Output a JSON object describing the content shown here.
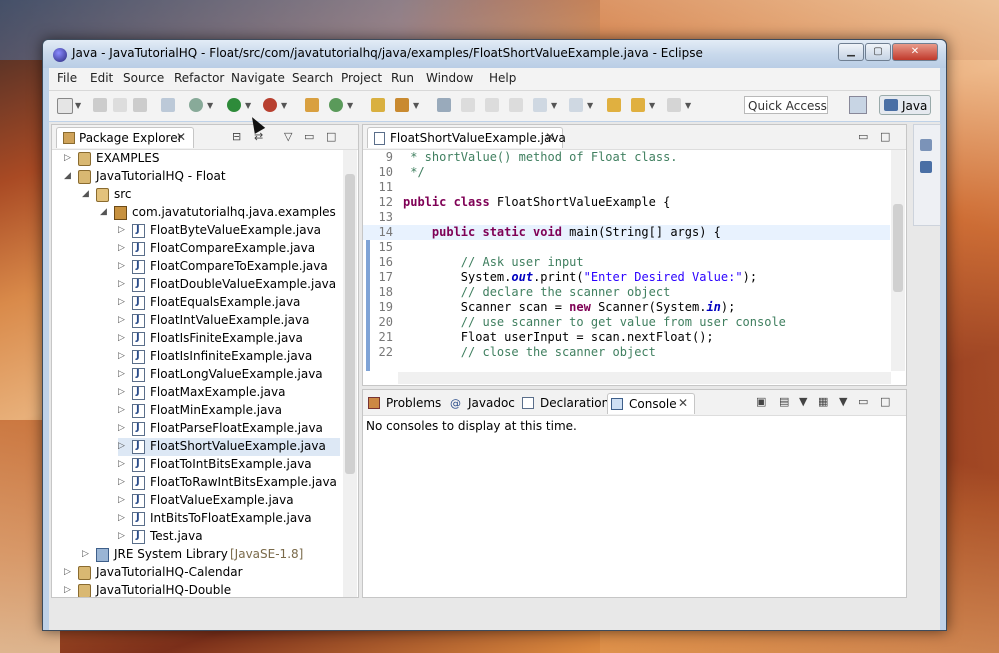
{
  "window": {
    "title": "Java - JavaTutorialHQ - Float/src/com/javatutorialhq/java/examples/FloatShortValueExample.java - Eclipse",
    "controls": [
      "minimize",
      "maximize",
      "close"
    ]
  },
  "menu": [
    "File",
    "Edit",
    "Source",
    "Refactor",
    "Navigate",
    "Search",
    "Project",
    "Run",
    "Window",
    "Help"
  ],
  "toolbar": {
    "quick_access": "Quick Access",
    "perspective": "Java"
  },
  "package_explorer": {
    "tab_label": "Package Explorer",
    "tree": [
      {
        "label": "EXAMPLES",
        "expanded": false,
        "type": "project"
      },
      {
        "label": "JavaTutorialHQ - Float",
        "expanded": true,
        "type": "project"
      },
      {
        "label": "src",
        "expanded": true,
        "type": "source-folder"
      },
      {
        "label": "com.javatutorialhq.java.examples",
        "expanded": true,
        "type": "package"
      },
      {
        "label": "FloatByteValueExample.java",
        "type": "java-file"
      },
      {
        "label": "FloatCompareExample.java",
        "type": "java-file"
      },
      {
        "label": "FloatCompareToExample.java",
        "type": "java-file"
      },
      {
        "label": "FloatDoubleValueExample.java",
        "type": "java-file"
      },
      {
        "label": "FloatEqualsExample.java",
        "type": "java-file"
      },
      {
        "label": "FloatIntValueExample.java",
        "type": "java-file"
      },
      {
        "label": "FloatIsFiniteExample.java",
        "type": "java-file"
      },
      {
        "label": "FloatIsInfiniteExample.java",
        "type": "java-file"
      },
      {
        "label": "FloatLongValueExample.java",
        "type": "java-file"
      },
      {
        "label": "FloatMaxExample.java",
        "type": "java-file"
      },
      {
        "label": "FloatMinExample.java",
        "type": "java-file"
      },
      {
        "label": "FloatParseFloatExample.java",
        "type": "java-file"
      },
      {
        "label": "FloatShortValueExample.java",
        "type": "java-file",
        "selected": true
      },
      {
        "label": "FloatToIntBitsExample.java",
        "type": "java-file"
      },
      {
        "label": "FloatToRawIntBitsExample.java",
        "type": "java-file"
      },
      {
        "label": "FloatValueExample.java",
        "type": "java-file"
      },
      {
        "label": "IntBitsToFloatExample.java",
        "type": "java-file"
      },
      {
        "label": "Test.java",
        "type": "java-file"
      },
      {
        "label": "JRE System Library",
        "suffix": "[JavaSE-1.8]",
        "type": "library"
      },
      {
        "label": "JavaTutorialHQ-Calendar",
        "expanded": false,
        "type": "project"
      },
      {
        "label": "JavaTutorialHQ-Double",
        "expanded": false,
        "type": "project"
      }
    ]
  },
  "editor": {
    "tab_label": "FloatShortValueExample.java",
    "lines": [
      {
        "n": "9",
        "segs": [
          {
            "t": " * shortValue() method of Float class.",
            "c": "cm"
          }
        ]
      },
      {
        "n": "10",
        "segs": [
          {
            "t": " */",
            "c": "cm"
          }
        ]
      },
      {
        "n": "11",
        "segs": []
      },
      {
        "n": "12",
        "segs": [
          {
            "t": "public class",
            "c": "kw"
          },
          {
            "t": " FloatShortValueExample {",
            "c": ""
          }
        ]
      },
      {
        "n": "13",
        "segs": []
      },
      {
        "n": "14",
        "current": true,
        "segs": [
          {
            "t": "    public static void",
            "c": "kw"
          },
          {
            "t": " main(String[] args) {",
            "c": ""
          }
        ]
      },
      {
        "n": "15",
        "segs": []
      },
      {
        "n": "16",
        "segs": [
          {
            "t": "        // Ask user input",
            "c": "cm"
          }
        ]
      },
      {
        "n": "17",
        "segs": [
          {
            "t": "        System.",
            "c": ""
          },
          {
            "t": "out",
            "c": "fi"
          },
          {
            "t": ".print(",
            "c": ""
          },
          {
            "t": "\"Enter Desired Value:\"",
            "c": "st"
          },
          {
            "t": ");",
            "c": ""
          }
        ]
      },
      {
        "n": "18",
        "segs": [
          {
            "t": "        // declare the scanner object",
            "c": "cm"
          }
        ]
      },
      {
        "n": "19",
        "segs": [
          {
            "t": "        Scanner scan = ",
            "c": ""
          },
          {
            "t": "new",
            "c": "kw"
          },
          {
            "t": " Scanner(System.",
            "c": ""
          },
          {
            "t": "in",
            "c": "fi"
          },
          {
            "t": ");",
            "c": ""
          }
        ]
      },
      {
        "n": "20",
        "segs": [
          {
            "t": "        // use scanner to get value from user console",
            "c": "cm"
          }
        ]
      },
      {
        "n": "21",
        "segs": [
          {
            "t": "        Float userInput = scan.nextFloat();",
            "c": ""
          }
        ]
      },
      {
        "n": "22",
        "segs": [
          {
            "t": "        // close the scanner object",
            "c": "cm"
          }
        ]
      }
    ]
  },
  "bottom_panel": {
    "tabs": [
      {
        "label": "Problems",
        "active": false
      },
      {
        "label": "Javadoc",
        "active": false
      },
      {
        "label": "Declaration",
        "active": false
      },
      {
        "label": "Console",
        "active": true
      }
    ],
    "message": "No consoles to display at this time."
  }
}
